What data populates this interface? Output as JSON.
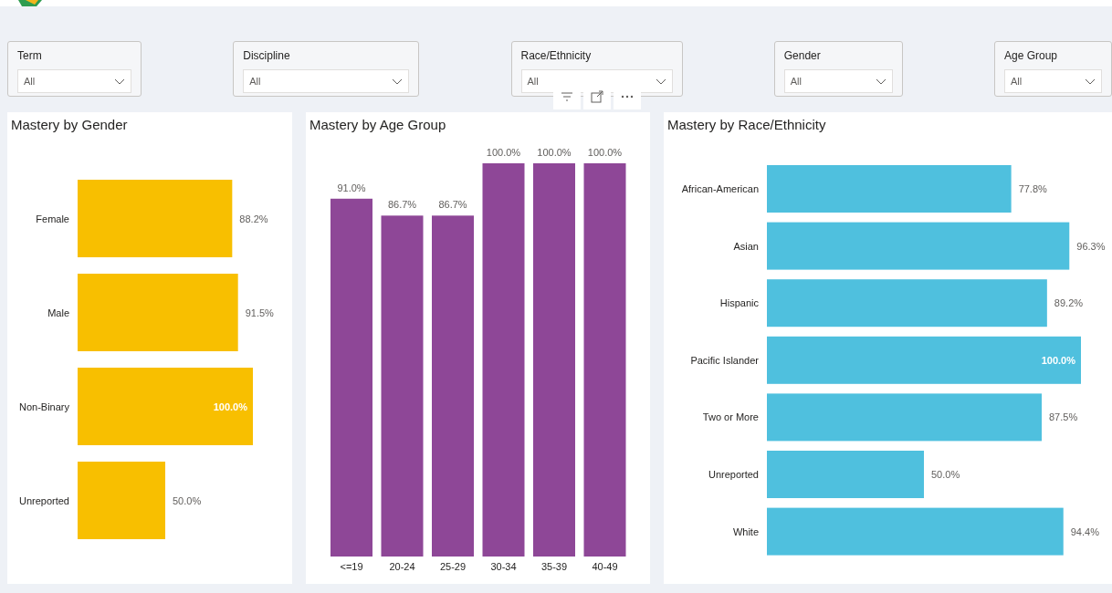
{
  "filters": [
    {
      "label": "Term",
      "value": "All"
    },
    {
      "label": "Discipline",
      "value": "All"
    },
    {
      "label": "Race/Ethnicity",
      "value": "All"
    },
    {
      "label": "Gender",
      "value": "All"
    },
    {
      "label": "Age Group",
      "value": "All"
    }
  ],
  "panels": [
    {
      "title": "Mastery by Gender",
      "chart_data": {
        "type": "bar",
        "orientation": "horizontal",
        "categories": [
          "Female",
          "Male",
          "Non-Binary",
          "Unreported"
        ],
        "values": [
          88.2,
          91.5,
          100,
          50
        ],
        "value_labels": [
          "88.2%",
          "91.5%",
          "100.0%",
          "50.0%"
        ]
      }
    },
    {
      "title": "Mastery by Age Group",
      "chart_data": {
        "type": "bar",
        "orientation": "vertical",
        "categories": [
          "<=19",
          "20-24",
          "25-29",
          "30-34",
          "35-39",
          "40-49"
        ],
        "values": [
          91,
          86.7,
          86.7,
          100,
          100,
          100
        ],
        "value_labels": [
          "91.0%",
          "86.7%",
          "86.7%",
          "100.0%",
          "100.0%",
          "100.0%"
        ]
      }
    },
    {
      "title": "Mastery by Race/Ethnicity",
      "chart_data": {
        "type": "bar",
        "orientation": "horizontal",
        "categories": [
          "African-American",
          "Asian",
          "Hispanic",
          "Pacific Islander",
          "Two or More",
          "Unreported",
          "White"
        ],
        "values": [
          77.8,
          96.3,
          89.2,
          100,
          87.5,
          50,
          94.4
        ],
        "value_labels": [
          "77.8%",
          "96.3%",
          "89.2%",
          "100.0%",
          "87.5%",
          "50.0%",
          "94.4%"
        ]
      }
    }
  ]
}
